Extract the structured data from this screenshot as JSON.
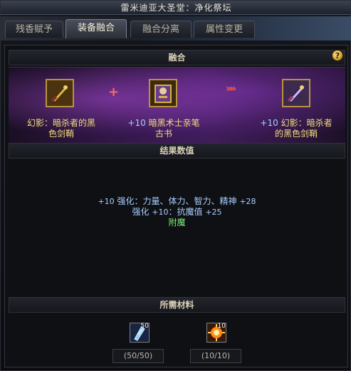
{
  "window": {
    "title": "雷米迪亚大圣堂：净化祭坛"
  },
  "tabs": [
    {
      "label": "残香赋予",
      "active": false
    },
    {
      "label": "装备融合",
      "active": true
    },
    {
      "label": "融合分离",
      "active": false
    },
    {
      "label": "属性变更",
      "active": false
    }
  ],
  "fusion": {
    "header": "融合",
    "help": "?",
    "item1": {
      "line1": "幻影：暗杀者的黑",
      "line2": "色剑鞘"
    },
    "item2": {
      "prefix": "+10",
      "line1": " 暗黑术士亲笔",
      "line2": "古书"
    },
    "result": {
      "prefix": "+10",
      "line1": " 幻影：暗杀者",
      "line2": "的黑色剑鞘"
    },
    "plus": "+",
    "arrows": "»»"
  },
  "results": {
    "header": "结果数值",
    "line1": {
      "prefix": "+10",
      "text": " 强化：力量、体力、智力、精神 ",
      "value": "+28"
    },
    "line2": {
      "text": "强化 ",
      "prefix": "+10",
      "text2": "：抗魔值 ",
      "value": "+25"
    },
    "line3": "附魔"
  },
  "materials": {
    "header": "所需材料",
    "items": [
      {
        "icon": "crystal-shard-icon",
        "count": "50",
        "qty": "(50/50)"
      },
      {
        "icon": "sun-orb-icon",
        "count": "10",
        "qty": "(10/10)"
      }
    ]
  },
  "colors": {
    "gold": "#f2dd7a",
    "blue": "#a9cfff",
    "green": "#7ef07a",
    "red": "#ff6b6b"
  }
}
